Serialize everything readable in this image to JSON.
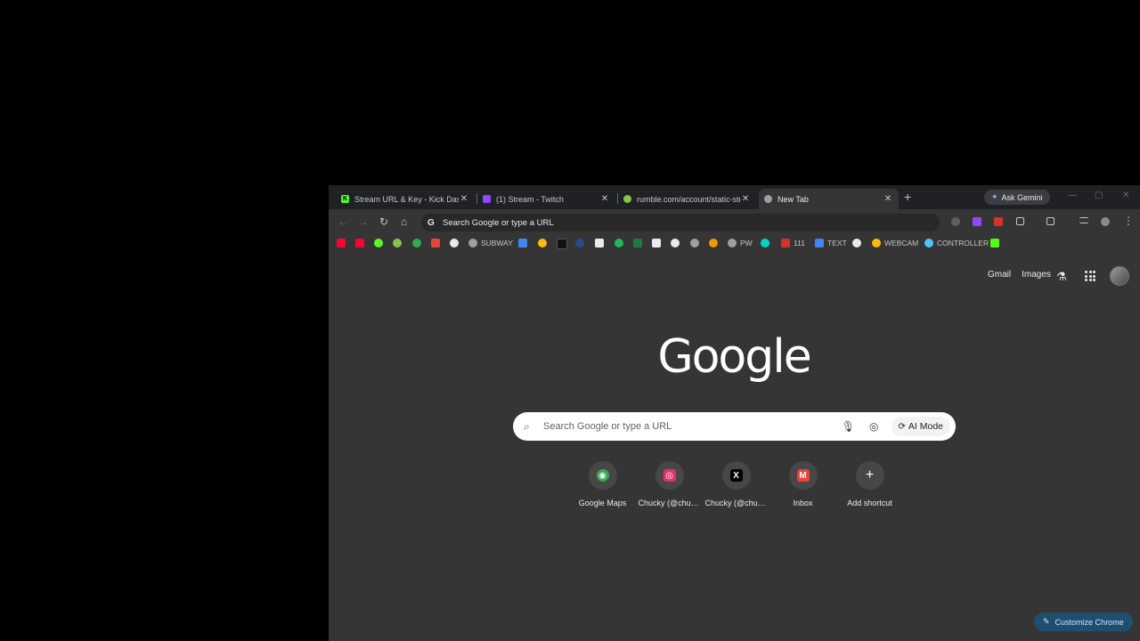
{
  "tabs": [
    {
      "title": "Stream URL & Key - Kick Dashboard",
      "favicon": "kick-icon",
      "color": "#53fc18",
      "active": false
    },
    {
      "title": "(1) Stream - Twitch",
      "favicon": "twitch-icon",
      "color": "#9146ff",
      "active": false
    },
    {
      "title": "rumble.com/account/static-stream",
      "favicon": "rumble-icon",
      "color": "#85c742",
      "active": false
    },
    {
      "title": "New Tab",
      "favicon": "chrome-icon",
      "color": "#9aa0a6",
      "active": true
    }
  ],
  "tab_close_glyph": "✕",
  "new_tab_glyph": "+",
  "gemini": {
    "label": "Ask Gemini",
    "icon": "✦"
  },
  "window_controls": {
    "minimize": "—",
    "maximize": "▢",
    "close": "✕"
  },
  "toolbar": {
    "back": "←",
    "forward": "→",
    "reload": "↻",
    "home": "⌂",
    "omnibox_text": "Search Google or type a URL",
    "omnibox_icon": "G"
  },
  "bookmarks": [
    {
      "label": "",
      "color": "#ff0033"
    },
    {
      "label": "",
      "color": "#ff0033"
    },
    {
      "label": "",
      "color": "#53fc18"
    },
    {
      "label": "",
      "color": "#85c742"
    },
    {
      "label": "",
      "color": "#34a853"
    },
    {
      "label": "",
      "color": "#ea4335"
    },
    {
      "label": "",
      "color": "#e8eaed"
    },
    {
      "label": "SUBWAY",
      "color": "#9aa0a6"
    },
    {
      "label": "",
      "color": "#4285f4"
    },
    {
      "label": "",
      "color": "#fbbc04"
    },
    {
      "label": "",
      "color": "#111111"
    },
    {
      "label": "",
      "color": "#2b4a8b"
    },
    {
      "label": "",
      "color": "#e8eaed"
    },
    {
      "label": "",
      "color": "#1db954"
    },
    {
      "label": "",
      "color": "#1b7d3a"
    },
    {
      "label": "",
      "color": "#e8eaed"
    },
    {
      "label": "",
      "color": "#e8eaed"
    },
    {
      "label": "",
      "color": "#9aa0a6"
    },
    {
      "label": "",
      "color": "#f29900"
    },
    {
      "label": "PW",
      "color": "#9aa0a6"
    },
    {
      "label": "",
      "color": "#00d4c8"
    },
    {
      "label": "111",
      "color": "#d93025"
    },
    {
      "label": "TEXT",
      "color": "#4285f4"
    },
    {
      "label": "",
      "color": "#e8eaed"
    },
    {
      "label": "WEBCAM",
      "color": "#fbbc04"
    },
    {
      "label": "CONTROLLER",
      "color": "#4fc3f7"
    },
    {
      "label": "",
      "color": "#53fc18"
    }
  ],
  "ntp": {
    "gmail": "Gmail",
    "images": "Images",
    "logo": "Google",
    "search_placeholder": "Search Google or type a URL",
    "ai_mode": "AI Mode",
    "shortcuts": [
      {
        "label": "Google Maps",
        "icon": "maps-pin-icon",
        "color": "#34a853",
        "glyph": "◉"
      },
      {
        "label": "Chucky (@chuc...",
        "icon": "instagram-icon",
        "color": "#e1306c",
        "glyph": "◎"
      },
      {
        "label": "Chucky (@chuc...",
        "icon": "x-icon",
        "color": "#000000",
        "glyph": "X"
      },
      {
        "label": "Inbox",
        "icon": "gmail-icon",
        "color": "#ea4335",
        "glyph": "M"
      },
      {
        "label": "Add shortcut",
        "icon": "plus-icon",
        "color": "#474747",
        "glyph": "+"
      }
    ],
    "customize": "Customize Chrome"
  }
}
